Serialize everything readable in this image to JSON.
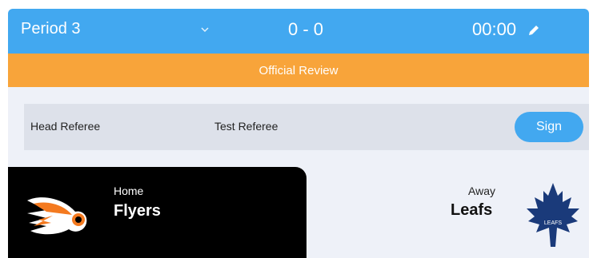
{
  "header": {
    "period": "Period 3",
    "score": "0 - 0",
    "clock": "00:00"
  },
  "banner": {
    "text": "Official Review"
  },
  "referee": {
    "role": "Head Referee",
    "name": "Test Referee",
    "sign_label": "Sign"
  },
  "home": {
    "label": "Home",
    "team": "Flyers",
    "logo_icon": "flyers-logo-icon"
  },
  "away": {
    "label": "Away",
    "team": "Leafs",
    "logo_icon": "leafs-logo-icon",
    "logo_text": "LEAFS"
  },
  "colors": {
    "header_blue": "#42a8f0",
    "review_orange": "#f8a43a",
    "panel_bg": "#eef1f8",
    "referee_row": "#dde1ea",
    "home_card": "#000000",
    "leafs_blue": "#1a3a7a"
  }
}
